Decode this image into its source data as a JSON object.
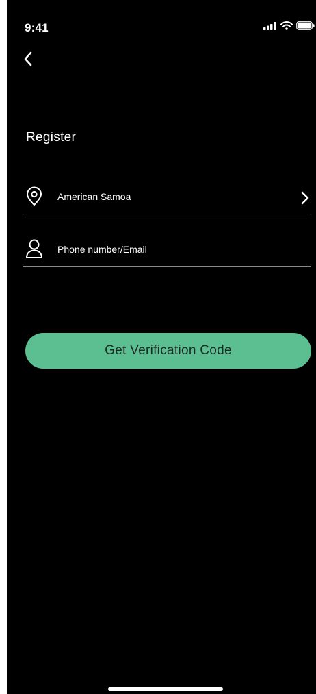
{
  "status_bar": {
    "time": "9:41",
    "icons": [
      "signal-icon",
      "wifi-icon",
      "battery-icon"
    ]
  },
  "navigation": {
    "back_icon": "chevron-left-icon"
  },
  "page": {
    "title": "Register"
  },
  "form": {
    "region": {
      "icon": "location-pin-icon",
      "value": "American Samoa",
      "chevron": "chevron-right-icon"
    },
    "account": {
      "icon": "user-icon",
      "placeholder": "Phone number/Email",
      "value": ""
    },
    "submit_label": "Get Verification Code"
  },
  "colors": {
    "background": "#000000",
    "accent": "#5cbf92",
    "text": "#ffffff",
    "divider": "#8a8a8a"
  }
}
